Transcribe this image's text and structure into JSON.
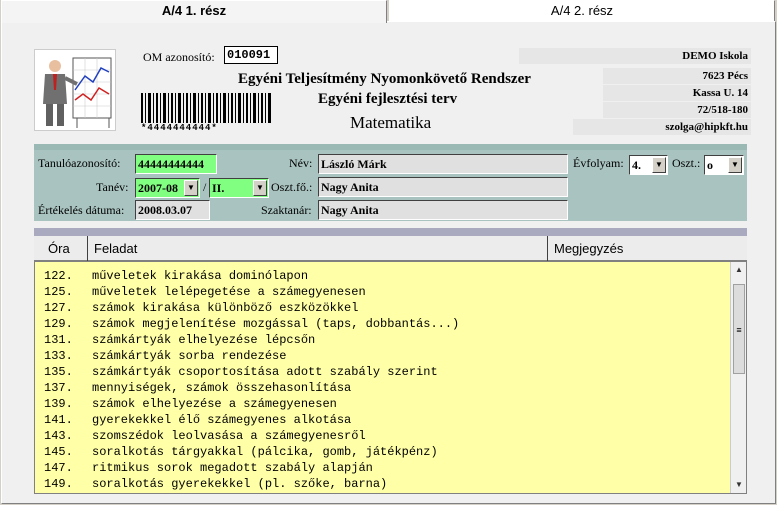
{
  "tabs": [
    {
      "label": "A/4 1. rész",
      "active": true
    },
    {
      "label": "A/4 2. rész",
      "active": false
    }
  ],
  "header": {
    "om_label": "OM azonosító:",
    "om_value": "010091",
    "barcode_text": "*4444444444*",
    "title1": "Egyéni Teljesítmény Nyomonkövető Rendszer",
    "title2": "Egyéni fejlesztési terv",
    "subject": "Matematika"
  },
  "school": {
    "name": "DEMO Iskola",
    "city": "7623 Pécs",
    "street": "Kassa U. 14",
    "phone": "72/518-180",
    "email": "szolga@hipkft.hu"
  },
  "student": {
    "id_label": "Tanulóazonosító:",
    "id_value": "44444444444",
    "name_label": "Név:",
    "name_value": "László Márk",
    "grade_label": "Évfolyam:",
    "grade_value": "4.",
    "class_label": "Oszt.:",
    "class_value": "o",
    "year_label": "Tanév:",
    "year_value": "2007-08",
    "semester_value": "II.",
    "head_label": "Oszt.fő.:",
    "head_value": "Nagy Anita",
    "eval_label": "Értékelés dátuma:",
    "eval_value": "2008.03.07",
    "teacher_label": "Szaktanár:",
    "teacher_value": "Nagy Anita"
  },
  "grid": {
    "columns": [
      "Óra",
      "Feladat",
      "Megjegyzés"
    ],
    "rows": [
      {
        "ora": "122.",
        "feladat": "műveletek kirakása dominólapon"
      },
      {
        "ora": "125.",
        "feladat": "műveletek lelépegetése a számegyenesen"
      },
      {
        "ora": "127.",
        "feladat": "számok kirakása különböző eszközökkel"
      },
      {
        "ora": "129.",
        "feladat": "számok megjelenítése mozgással (taps, dobbantás...)"
      },
      {
        "ora": "131.",
        "feladat": "számkártyák elhelyezése lépcsőn"
      },
      {
        "ora": "133.",
        "feladat": "számkártyák sorba rendezése"
      },
      {
        "ora": "135.",
        "feladat": "számkártyák csoportosítása adott szabály szerint"
      },
      {
        "ora": "137.",
        "feladat": "mennyiségek, számok összehasonlítása"
      },
      {
        "ora": "139.",
        "feladat": "számok elhelyezése a számegyenesen"
      },
      {
        "ora": "141.",
        "feladat": "gyerekekkel élő számegyenes alkotása"
      },
      {
        "ora": "143.",
        "feladat": "szomszédok leolvasása a számegyenesről"
      },
      {
        "ora": "145.",
        "feladat": "soralkotás tárgyakkal (pálcika, gomb, játékpénz)"
      },
      {
        "ora": "147.",
        "feladat": "ritmikus sorok megadott szabály alapján"
      },
      {
        "ora": "149.",
        "feladat": "soralkotás gyerekekkel (pl. szőke, barna)"
      }
    ]
  }
}
